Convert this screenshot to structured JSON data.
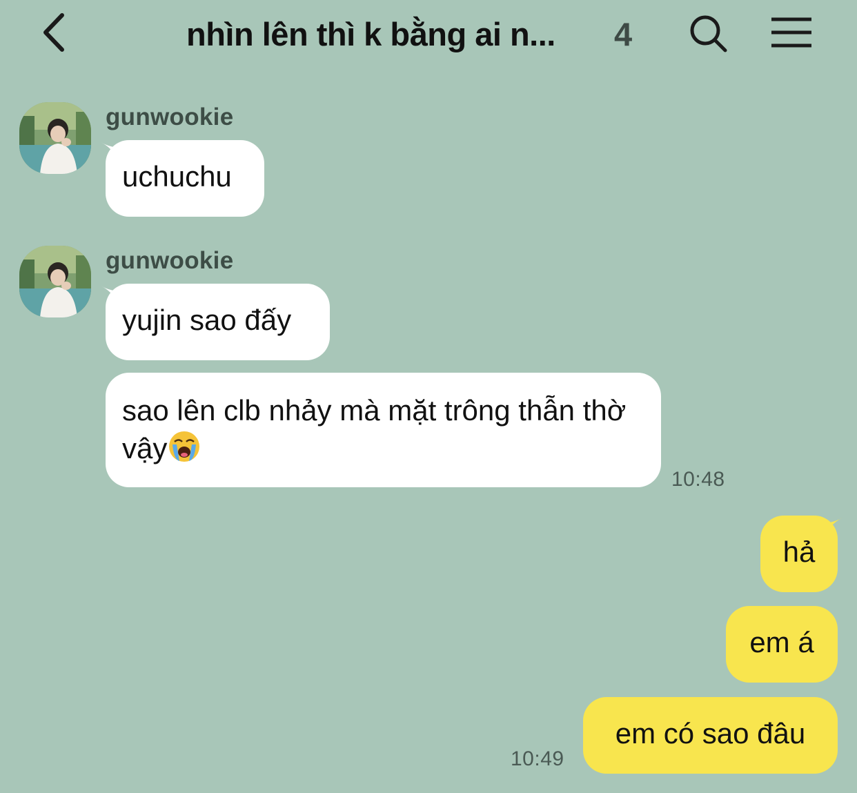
{
  "header": {
    "title": "nhìn lên thì k bằng ai n...",
    "member_count": "4"
  },
  "messages": [
    {
      "sender": "gunwookie",
      "text": "uchuchu"
    },
    {
      "sender": "gunwookie",
      "text": "yujin sao đấy"
    },
    {
      "sender": "",
      "text": "sao lên clb nhảy mà mặt trông thẫn thờ vậy",
      "emoji": "loudly-crying-face",
      "time": "10:48"
    },
    {
      "sender": "me",
      "text": "hả"
    },
    {
      "sender": "me",
      "text": "em á"
    },
    {
      "sender": "me",
      "text": "em có sao đâu",
      "time": "10:49"
    }
  ],
  "colors": {
    "background": "#a8c6b8",
    "incoming_bubble": "#ffffff",
    "outgoing_bubble": "#f8e54e"
  }
}
